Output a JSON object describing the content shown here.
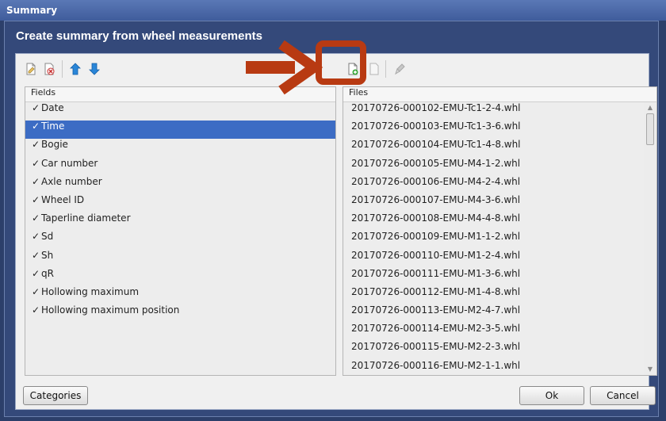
{
  "window": {
    "title": "Summary",
    "dialog_title": "Create summary from wheel measurements"
  },
  "toolbar": {
    "icons": [
      "new-file-icon",
      "delete-file-icon",
      "move-up-icon",
      "move-down-icon",
      "add-file-icon",
      "copy-file-icon",
      "clear-icon"
    ]
  },
  "fields": {
    "header": "Fields",
    "items": [
      {
        "label": "Date",
        "checked": true,
        "selected": false
      },
      {
        "label": "Time",
        "checked": true,
        "selected": true
      },
      {
        "label": "Bogie",
        "checked": true,
        "selected": false
      },
      {
        "label": "Car number",
        "checked": true,
        "selected": false
      },
      {
        "label": "Axle number",
        "checked": true,
        "selected": false
      },
      {
        "label": "Wheel ID",
        "checked": true,
        "selected": false
      },
      {
        "label": "Taperline diameter",
        "checked": true,
        "selected": false
      },
      {
        "label": "Sd",
        "checked": true,
        "selected": false
      },
      {
        "label": "Sh",
        "checked": true,
        "selected": false
      },
      {
        "label": "qR",
        "checked": true,
        "selected": false
      },
      {
        "label": "Hollowing maximum",
        "checked": true,
        "selected": false
      },
      {
        "label": "Hollowing maximum position",
        "checked": true,
        "selected": false
      }
    ]
  },
  "files": {
    "header": "Files",
    "items": [
      "20170726-000102-EMU-Tc1-2-4.whl",
      "20170726-000103-EMU-Tc1-3-6.whl",
      "20170726-000104-EMU-Tc1-4-8.whl",
      "20170726-000105-EMU-M4-1-2.whl",
      "20170726-000106-EMU-M4-2-4.whl",
      "20170726-000107-EMU-M4-3-6.whl",
      "20170726-000108-EMU-M4-4-8.whl",
      "20170726-000109-EMU-M1-1-2.whl",
      "20170726-000110-EMU-M1-2-4.whl",
      "20170726-000111-EMU-M1-3-6.whl",
      "20170726-000112-EMU-M1-4-8.whl",
      "20170726-000113-EMU-M2-4-7.whl",
      "20170726-000114-EMU-M2-3-5.whl",
      "20170726-000115-EMU-M2-2-3.whl",
      "20170726-000116-EMU-M2-1-1.whl"
    ]
  },
  "buttons": {
    "categories": "Categories",
    "ok": "Ok",
    "cancel": "Cancel"
  },
  "colors": {
    "selection": "#3c6cc4",
    "annotation": "#b83a12",
    "frame": "#34497a"
  }
}
